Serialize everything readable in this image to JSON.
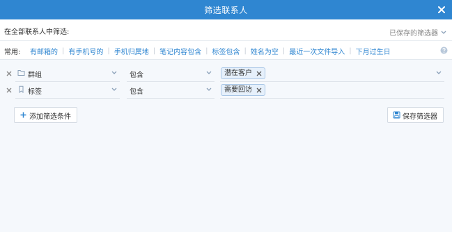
{
  "dialog": {
    "title": "筛选联系人",
    "close_icon": "close-icon"
  },
  "scope": {
    "label": "在全部联系人中筛选:",
    "saved_filters_label": "已保存的筛选器"
  },
  "common": {
    "label": "常用:",
    "links": [
      "有邮箱的",
      "有手机号的",
      "手机归属地",
      "笔记内容包含",
      "标签包含",
      "姓名为空",
      "最近一次文件导入",
      "下月过生日"
    ]
  },
  "conditions": [
    {
      "field_icon": "folder-icon",
      "field": "群组",
      "operator": "包含",
      "tags": [
        "潜在客户"
      ]
    },
    {
      "field_icon": "bookmark-icon",
      "field": "标签",
      "operator": "包含",
      "tags": [
        "需要回访"
      ]
    }
  ],
  "actions": {
    "add_condition": "添加筛选条件",
    "save_filter": "保存筛选器"
  },
  "colors": {
    "header": "#2f86d1",
    "link": "#2f86d1",
    "tag_bg": "#e6f0fb",
    "tag_border": "#a9c6e6"
  }
}
